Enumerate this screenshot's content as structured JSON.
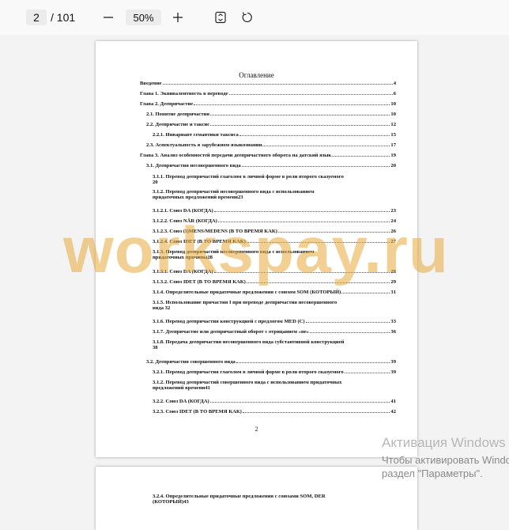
{
  "toolbar": {
    "current_page": "2",
    "total_pages": "/ 101",
    "zoom": "50%",
    "icons": [
      "zoom-out-icon",
      "zoom-in-icon",
      "fit-page-icon",
      "rotate-icon"
    ]
  },
  "page1": {
    "toc_title": "Оглавление",
    "entries": [
      {
        "text": "Введение",
        "page": "4"
      },
      {
        "text": "Глава 1. Эквивалентность в переводе",
        "page": "6"
      },
      {
        "text": "Глава 2. Деепричастие",
        "page": "10"
      },
      {
        "text": "2.1. Понятие деепричастия",
        "page": "10"
      },
      {
        "text": "2.2. Деепричастие и таксис",
        "page": "12"
      },
      {
        "text": "2.2.1. Инвариант семантики таксиса",
        "page": "15"
      },
      {
        "text": "2.3. Аспектуальность в зарубежном языкознании",
        "page": "17"
      },
      {
        "text": "Глава 3. Анализ особенностей передачи деепричастного оборота на датский язык",
        "page": "19"
      },
      {
        "text": "3.1. Деепричастия несовершенного вида",
        "page": "20"
      },
      {
        "line1": "3.1.1.      Перевод деепричастий глаголом в личной форме в роли второго сказуемого",
        "line2": "20",
        "page": ""
      },
      {
        "line1": "3.1.2.      Перевод деепричастий несовершенного вида с использованием",
        "line2": "придаточных предложений времени",
        "page": "23"
      },
      {
        "text": "3.1.2.1. Союз DA (КОГДА)",
        "page": "23"
      },
      {
        "text": "3.1.2.2. Союз NÅR (КОГДА)",
        "page": "24"
      },
      {
        "text": "3.1.2.3. Союз (I)MENS/MEDENS (В ТО ВРЕМЯ КАК)",
        "page": "26"
      },
      {
        "text": "3.1.2.4. Союз IDET (В ТО ВРЕМЯ КАК)",
        "page": "27"
      },
      {
        "line1": "3.1.3.      Перевод деепричастий несовершенного вида с использованием",
        "line2": "придаточных причины",
        "page": "28"
      },
      {
        "text": "3.1.3.1. Союз DA (КОГДА)",
        "page": "28"
      },
      {
        "text": "3.1.3.2. Союз IDET (В ТО ВРЕМЯ КАК)",
        "page": "29"
      },
      {
        "text": "3.1.4.      Определительные придаточные предложения с союзом SOM (КОТОРЫЙ)",
        "page": "31"
      },
      {
        "line1": "3.1.5.      Использование причастия I при переводе деепричастия несовершенного",
        "line2": "вида     32",
        "page": ""
      },
      {
        "text": "3.1.6.      Перевод деепричастия конструкцией с предлогом MED (С)",
        "page": "33"
      },
      {
        "text": "3.1.7.      Деепричастие или деепричастный оборот с отрицанием «не»",
        "page": "36"
      },
      {
        "line1": "3.1.8.      Передача деепричастия несовершенного вида субстантивной конструкцией",
        "line2": "38",
        "page": ""
      },
      {
        "text": "3.2. Деепричастия совершенного вида",
        "page": "39"
      },
      {
        "text": "3.2.1. Перевод деепричастия глаголом в личной форме в роли второго сказуемого",
        "page": "39"
      },
      {
        "line1": "3.1.2. Перевод деепричастий совершенного вида с использованием придаточных",
        "line2": "предложений времени",
        "page": "41"
      },
      {
        "text": "3.2.2. Союз DA (КОГДА)",
        "page": "41"
      },
      {
        "text": "3.2.3. Союз IDET (В ТО ВРЕМЯ КАК)",
        "page": "42"
      }
    ],
    "page_number": "2"
  },
  "page2": {
    "entry": {
      "line1": "3.2.4. Определительные придаточные предложения с союзами SOM, DER",
      "line2": "(КОТОРЫЙ)",
      "page": "43"
    }
  },
  "watermark": "workspay.ru",
  "activation": {
    "title": "Активация Windows",
    "line1": "Чтобы активировать Windows, перейдите в",
    "line2": "раздел \"Параметры\"."
  },
  "colors": {
    "watermark": "#e8aa3c",
    "toolbar_bg": "#f9f9f9",
    "viewer_bg": "#f3f3f3"
  }
}
